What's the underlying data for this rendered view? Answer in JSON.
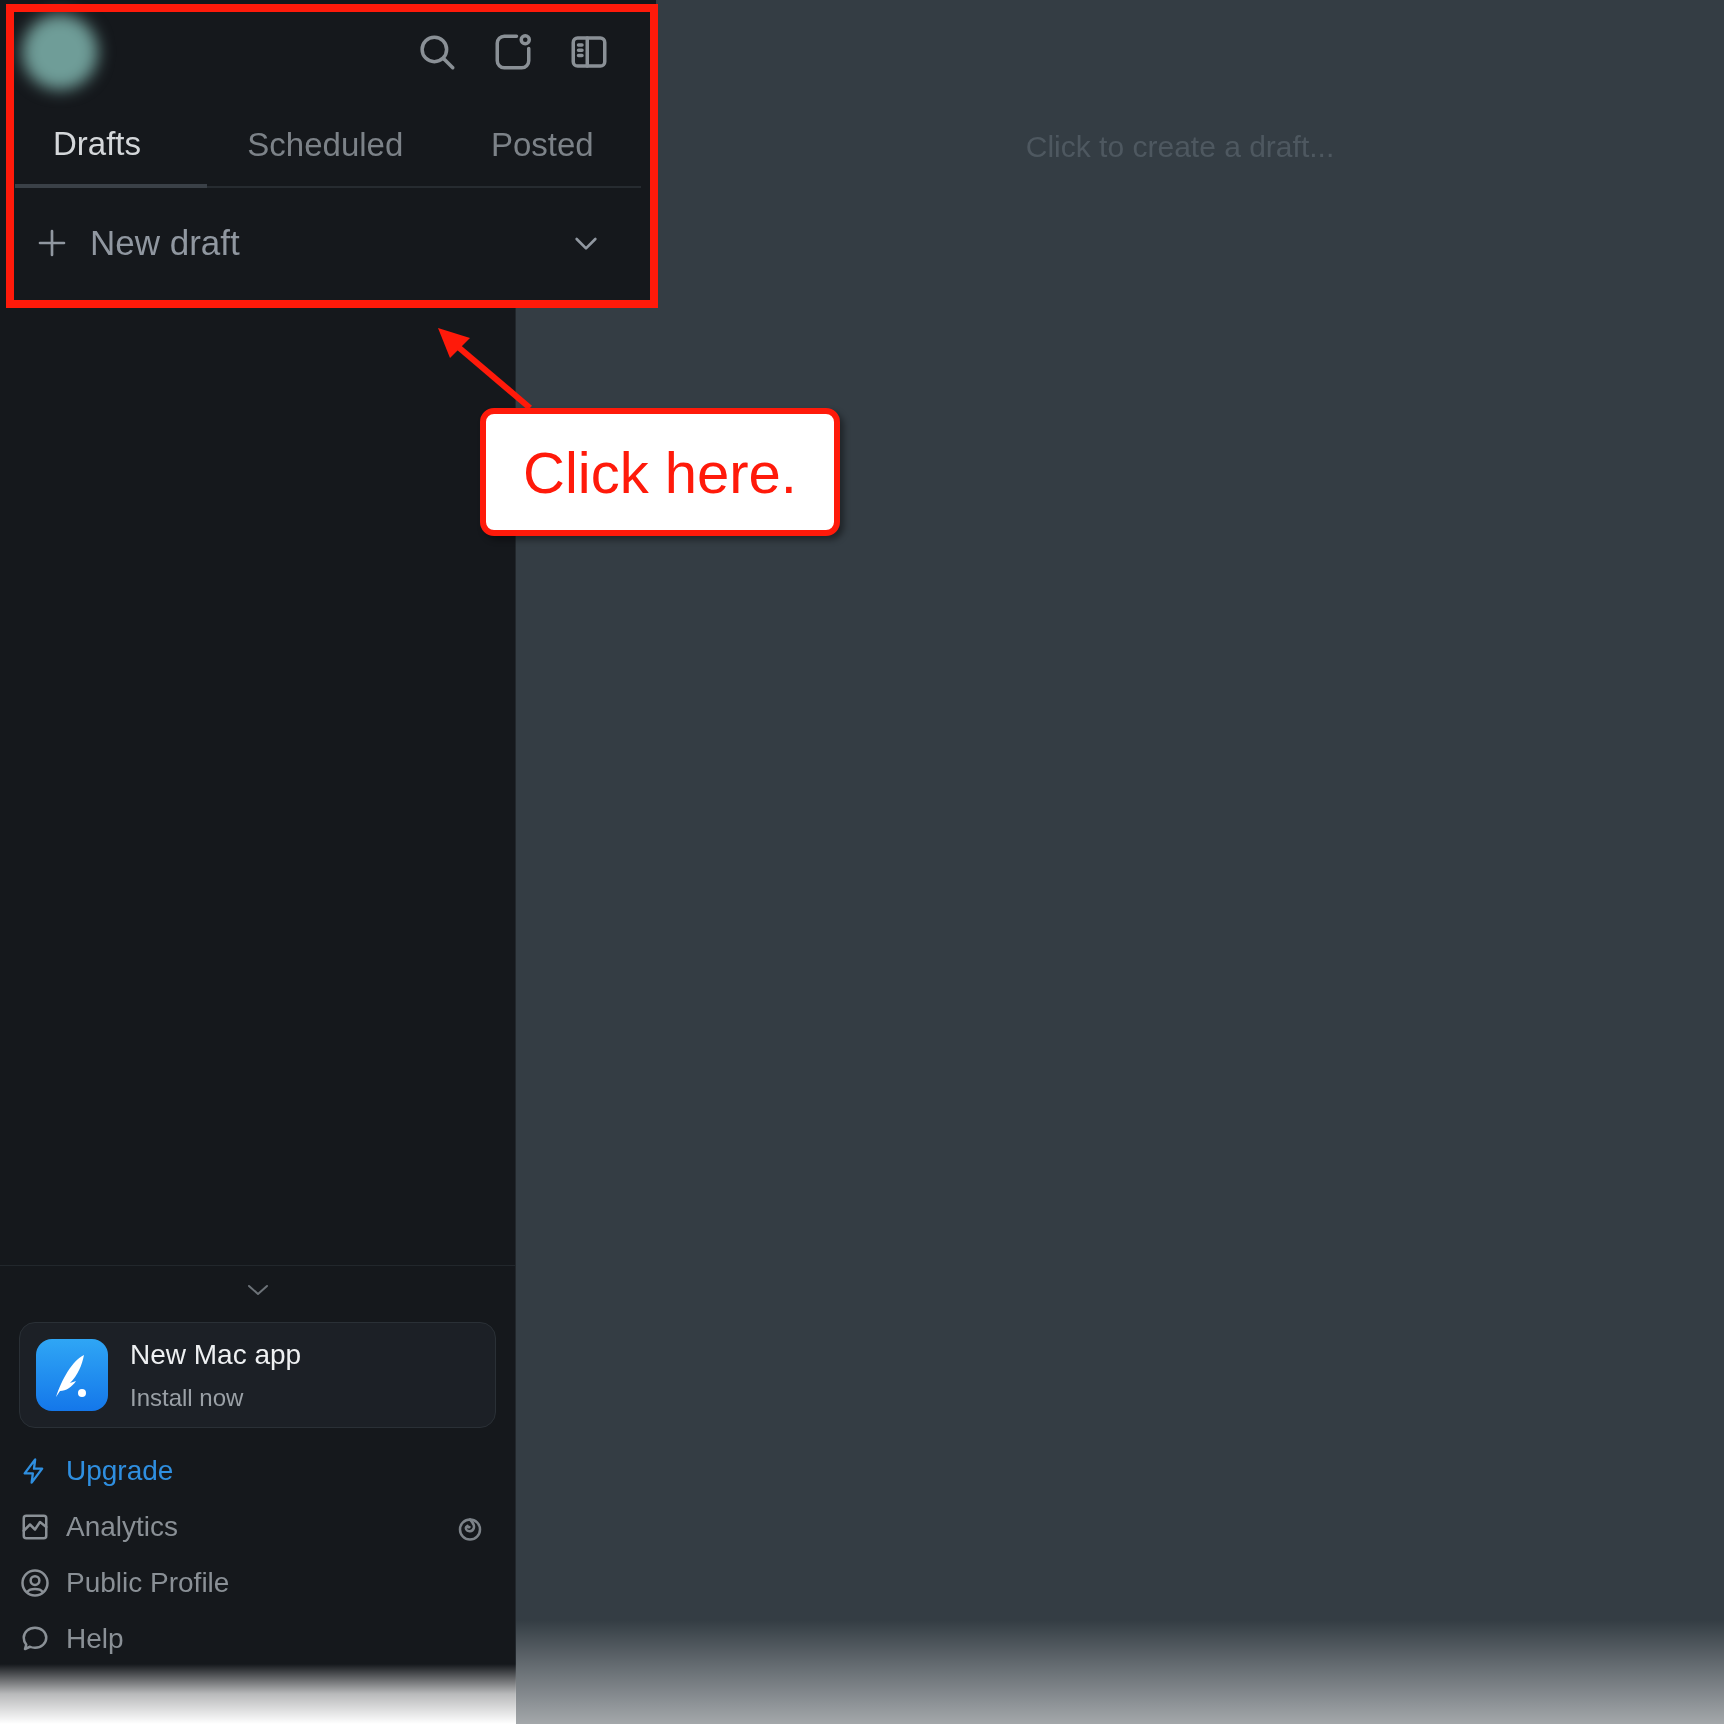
{
  "sidebar": {
    "tabs": [
      {
        "label": "Drafts",
        "selected": true
      },
      {
        "label": "Scheduled",
        "selected": false
      },
      {
        "label": "Posted",
        "selected": false
      }
    ],
    "new_draft": {
      "label": "New draft"
    },
    "promo": {
      "title": "New Mac app",
      "subtitle": "Install now"
    },
    "nav_items": [
      {
        "label": "Upgrade",
        "kind": "upgrade"
      },
      {
        "label": "Analytics",
        "kind": "analytics"
      },
      {
        "label": "Public Profile",
        "kind": "profile"
      },
      {
        "label": "Help",
        "kind": "help"
      }
    ]
  },
  "editor": {
    "placeholder": "Click to create a draft..."
  },
  "annotation": {
    "callout": "Click here."
  }
}
